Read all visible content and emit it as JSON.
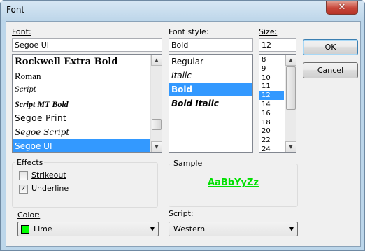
{
  "window": {
    "title": "Font",
    "close_glyph": "✕"
  },
  "font": {
    "label": "Font:",
    "value": "Segoe UI",
    "items": [
      {
        "label": "Rockwell Extra Bold",
        "css": "font-family:'DejaVu Serif',serif;font-weight:bold;font-size:13px;"
      },
      {
        "label": "Roman",
        "css": "font-family:'Liberation Serif',serif;font-size:13px;"
      },
      {
        "label": "Script",
        "css": "font-family:'DejaVu Serif',serif;font-style:italic;font-size:10px;"
      },
      {
        "label": "Script MT Bold",
        "css": "font-family:'Liberation Serif',serif;font-style:italic;font-weight:bold;font-size:12px;"
      },
      {
        "label": "Segoe Print",
        "css": "font-family:'DejaVu Sans',sans-serif;font-size:12px;letter-spacing:0.5px;"
      },
      {
        "label": "Segoe Script",
        "css": "font-family:'DejaVu Serif',serif;font-style:italic;font-size:12px;"
      },
      {
        "label": "Segoe UI",
        "css": "font-family:'DejaVu Sans',sans-serif;font-size:12px;"
      }
    ],
    "selected": "Segoe UI"
  },
  "style": {
    "label": "Font style:",
    "value": "Bold",
    "items": [
      "Regular",
      "Italic",
      "Bold",
      "Bold Italic"
    ],
    "selected": "Bold"
  },
  "size": {
    "label": "Size:",
    "value": "12",
    "items": [
      "8",
      "9",
      "10",
      "11",
      "12",
      "14",
      "16",
      "18",
      "20",
      "22",
      "24"
    ],
    "selected": "12"
  },
  "buttons": {
    "ok": "OK",
    "cancel": "Cancel"
  },
  "effects": {
    "title": "Effects",
    "strikeout": {
      "label": "Strikeout",
      "checked": false
    },
    "underline": {
      "label": "Underline",
      "checked": true
    }
  },
  "color": {
    "label": "Color:",
    "value": "Lime",
    "swatch": "#00ff00"
  },
  "sample": {
    "title": "Sample",
    "text": "AaBbYyZz",
    "color": "#00e000"
  },
  "script": {
    "label": "Script:",
    "value": "Western"
  },
  "icons": {
    "scroll_up": "up-arrow-icon",
    "scroll_down": "down-arrow-icon",
    "dropdown": "chevron-down-icon",
    "check": "check-icon"
  }
}
